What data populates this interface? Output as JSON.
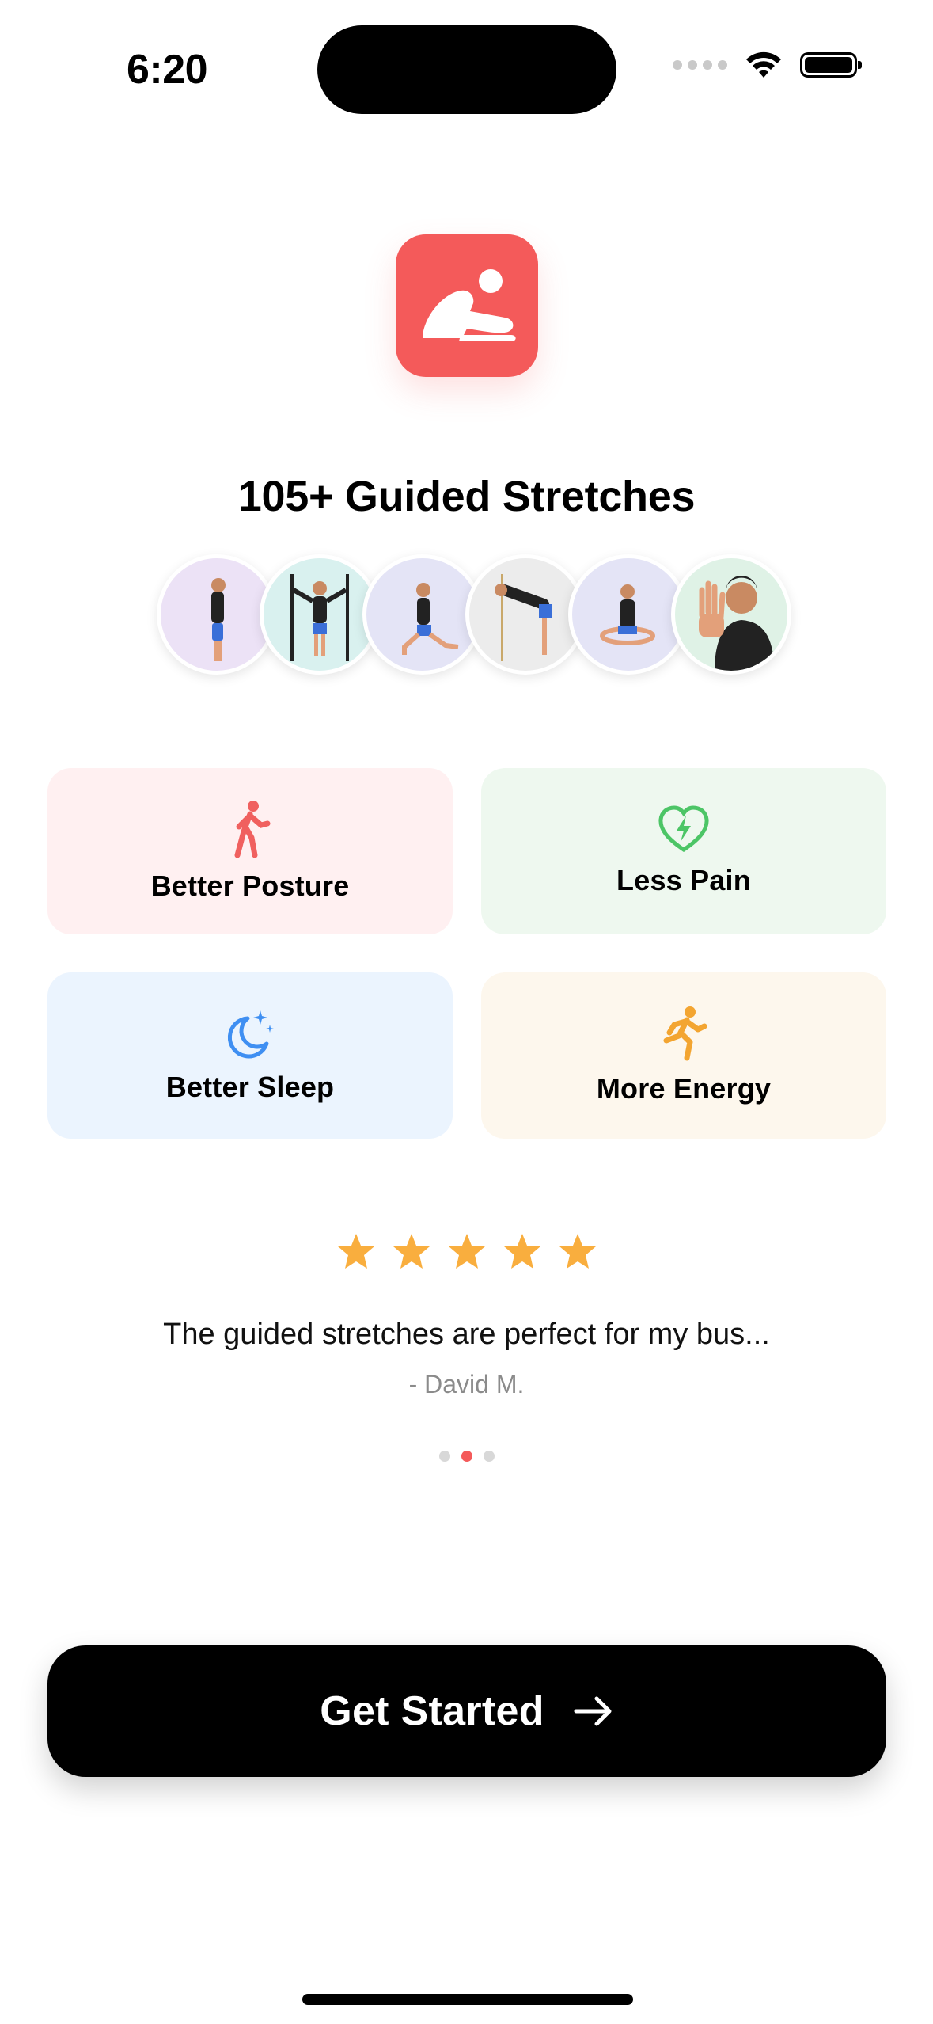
{
  "status_bar": {
    "time": "6:20"
  },
  "app": {
    "icon_name": "stretch-icon",
    "icon_color": "#f45a5a"
  },
  "headline": "105+ Guided Stretches",
  "avatars": [
    {
      "pose": "standing-side",
      "bg": "#ece2f6"
    },
    {
      "pose": "doorway-stretch",
      "bg": "#d9f1ef"
    },
    {
      "pose": "lunge",
      "bg": "#e4e4f6"
    },
    {
      "pose": "forward-bend",
      "bg": "#ececec"
    },
    {
      "pose": "seated-cross-legged",
      "bg": "#e4e4f6"
    },
    {
      "pose": "hand-wave",
      "bg": "#dff2e6"
    }
  ],
  "benefits": [
    {
      "label": "Better Posture",
      "icon": "walking-person-icon",
      "color": "#f0605f"
    },
    {
      "label": "Less Pain",
      "icon": "heart-bolt-icon",
      "color": "#4cc566"
    },
    {
      "label": "Better Sleep",
      "icon": "moon-stars-icon",
      "color": "#3f8ff2"
    },
    {
      "label": "More Energy",
      "icon": "running-person-icon",
      "color": "#f3a531"
    }
  ],
  "rating": {
    "stars": 5,
    "star_color": "#f9ae3e"
  },
  "testimonial": {
    "quote": "The guided stretches are perfect for my bus...",
    "author": "- David M."
  },
  "carousel": {
    "pages": 3,
    "active_index": 1
  },
  "cta": {
    "label": "Get Started",
    "icon": "arrow-right-icon"
  }
}
